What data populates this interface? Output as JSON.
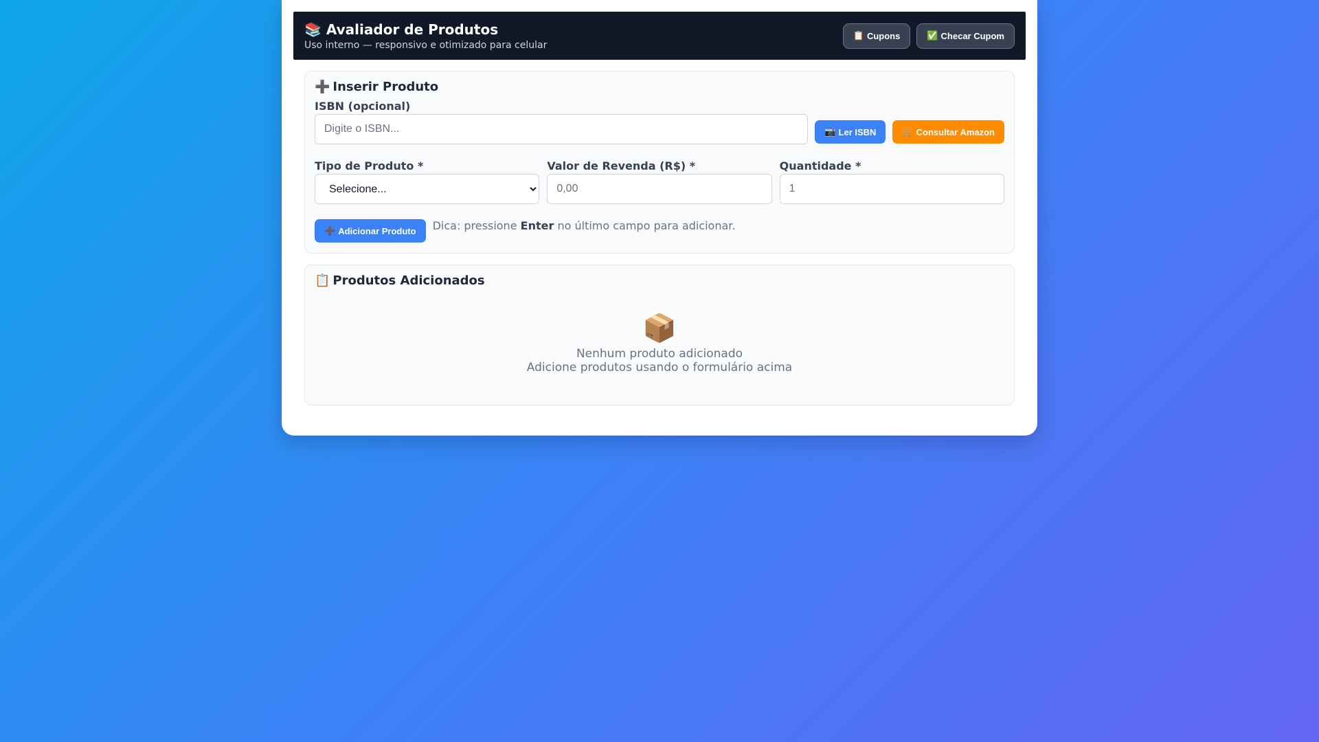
{
  "header": {
    "icon": "books-icon",
    "icon_glyph": "📚",
    "title": "Avaliador de Produtos",
    "subtitle": "Uso interno — responsivo e otimizado para celular",
    "buttons": [
      {
        "icon_glyph": "📋",
        "label": "Cupons"
      },
      {
        "icon_glyph": "✅",
        "label": "Checar Cupom"
      }
    ]
  },
  "insert": {
    "icon_glyph": "➕",
    "title": "Inserir Produto",
    "isbn_label": "ISBN (opcional)",
    "isbn_placeholder": "Digite o ISBN...",
    "isbn_value": "",
    "read_isbn": {
      "icon_glyph": "📷",
      "label": "Ler ISBN"
    },
    "amazon": {
      "icon_glyph": "🛒",
      "label": "Consultar Amazon"
    },
    "type_label": "Tipo de Produto *",
    "type_selected": "Selecione...",
    "price_label": "Valor de Revenda (R$) *",
    "price_placeholder": "0,00",
    "qty_label": "Quantidade *",
    "qty_placeholder": "1",
    "add_button": {
      "icon_glyph": "➕",
      "label": "Adicionar Produto"
    },
    "hint_before": "Dica: pressione",
    "hint_key": "Enter",
    "hint_after": "no último campo para adicionar."
  },
  "added": {
    "icon_glyph": "📋",
    "title": "Produtos Adicionados",
    "empty_icon_glyph": "📦",
    "empty_title": "Nenhum produto adicionado",
    "empty_sub": "Adicione produtos usando o formulário acima"
  },
  "colors": {
    "header_bg": "#111827",
    "primary": "#3b82f6",
    "amazon": "#ff8c00"
  }
}
